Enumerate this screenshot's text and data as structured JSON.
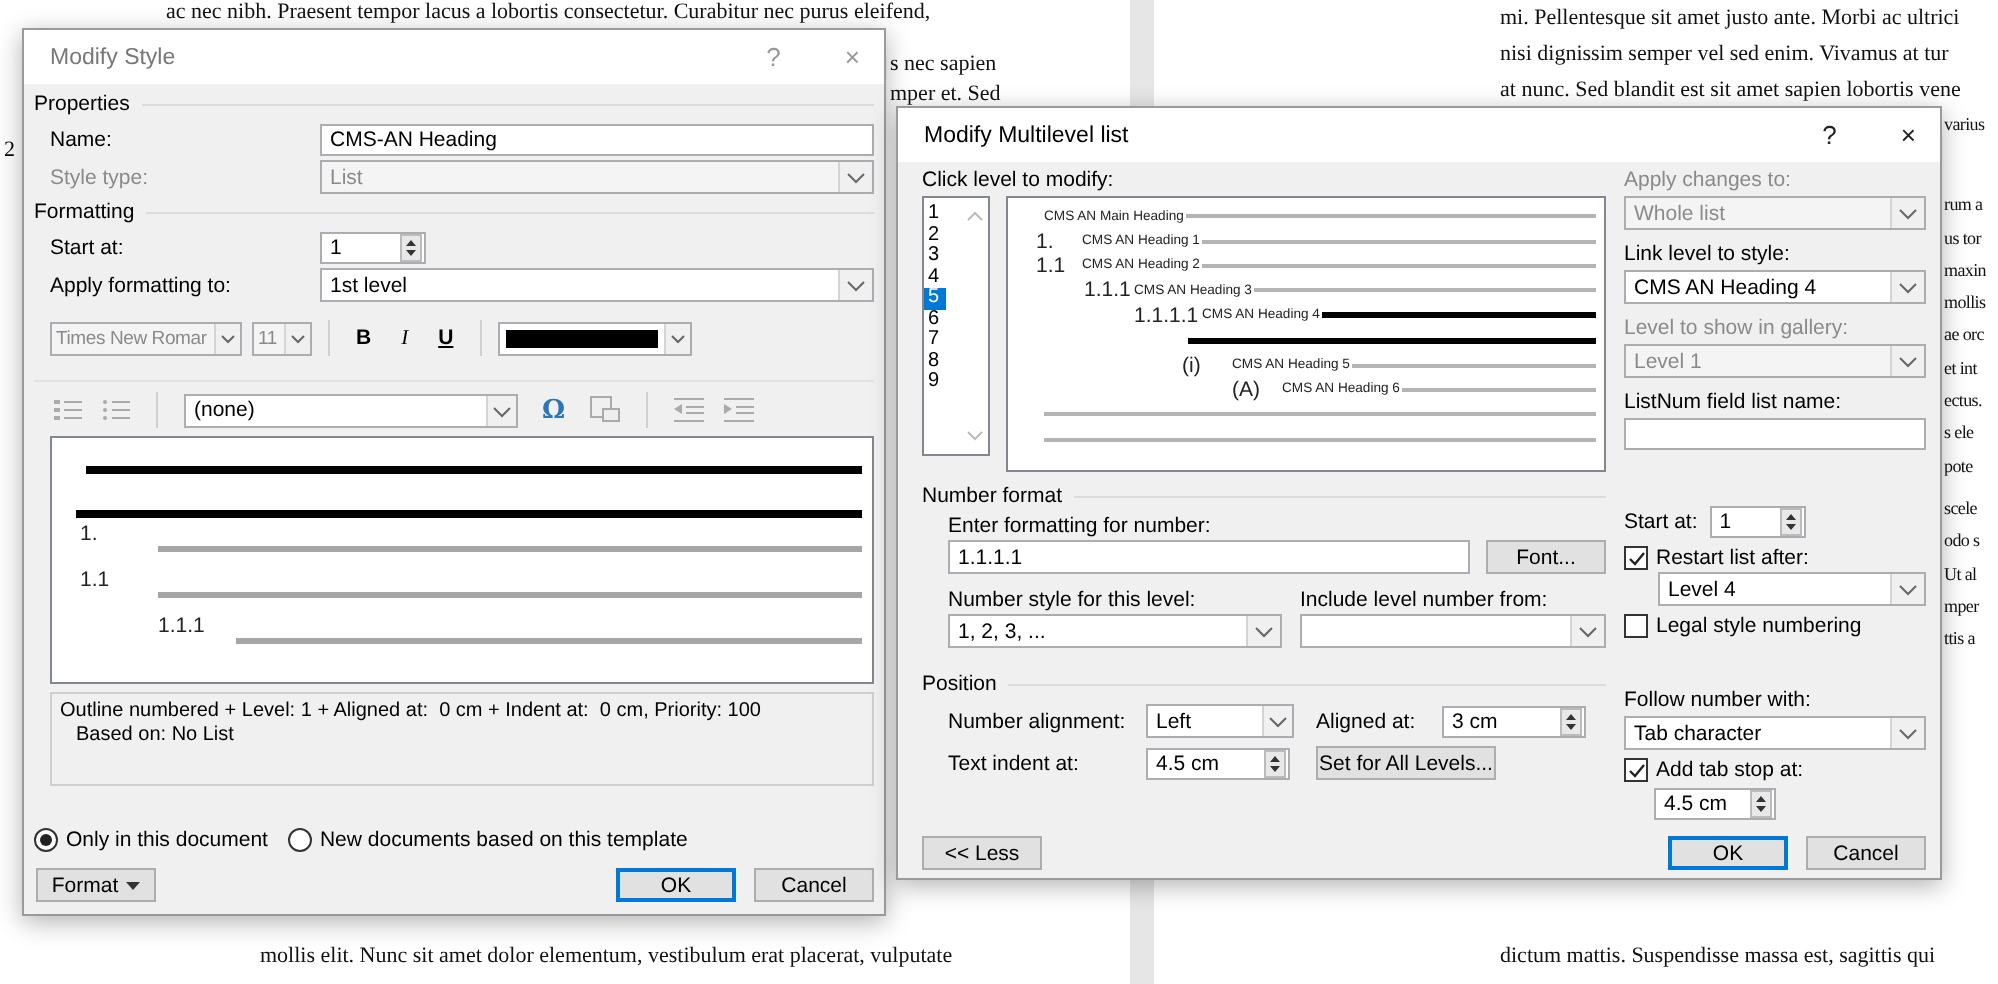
{
  "document": {
    "left_top_line": "ac nec nibh. Praesent tempor lacus a lobortis consectetur. Curabitur nec purus eleifend,",
    "left_fragments": [
      "s nec sapien",
      "mper et. Sed"
    ],
    "left_margin_number": "2",
    "left_bottom_line": "mollis elit. Nunc sit amet dolor elementum, vestibulum erat placerat, vulputate",
    "right_top_lines": [
      "mi. Pellentesque sit amet justo ante. Morbi ac ultrici",
      "nisi dignissim semper vel sed enim. Vivamus at tur",
      "at nunc. Sed blandit est sit amet sapien lobortis vene"
    ],
    "right_fragment_paragraphs": [
      [
        "varius"
      ],
      [
        "rum a",
        "us tor",
        "maxin",
        "mollis",
        "ae orc",
        "et int",
        "ectus.",
        "s ele",
        "pote"
      ],
      [
        "scele",
        "odo s",
        "Ut al",
        "mper",
        "ttis a"
      ]
    ],
    "right_bottom_line": "dictum mattis. Suspendisse massa est, sagittis qui"
  },
  "modify_style": {
    "title": "Modify Style",
    "help": "?",
    "close": "×",
    "properties_heading": "Properties",
    "name": {
      "label": "Name:",
      "value": "CMS-AN Heading"
    },
    "style_type": {
      "label": "Style type:",
      "value": "List",
      "disabled": true
    },
    "formatting_heading": "Formatting",
    "start_at": {
      "label": "Start at:",
      "value": "1"
    },
    "apply_to": {
      "label": "Apply formatting to:",
      "value": "1st level"
    },
    "font": "Times New Romar",
    "font_size": "11",
    "bold": "B",
    "italic": "I",
    "underline": "U",
    "list_style": "(none)",
    "symbol": "Ω",
    "preview_numbers": [
      "1.",
      "1.1",
      "1.1.1"
    ],
    "description": [
      "Outline numbered + Level: 1 + Aligned at:  0 cm + Indent at:  0 cm, Priority: 100",
      "Based on: No List"
    ],
    "scope_options": [
      {
        "label": "Only in this document",
        "selected": true
      },
      {
        "label": "New documents based on this template",
        "selected": false
      }
    ],
    "format_button": "Format",
    "ok": "OK",
    "cancel": "Cancel"
  },
  "multilevel": {
    "title": "Modify Multilevel list",
    "help": "?",
    "close": "×",
    "level_label": "Click level to modify:",
    "levels": [
      {
        "label": "1",
        "selected": false
      },
      {
        "label": "2",
        "selected": false
      },
      {
        "label": "3",
        "selected": false
      },
      {
        "label": "4",
        "selected": false
      },
      {
        "label": "5",
        "selected": true
      },
      {
        "label": "6",
        "selected": false
      },
      {
        "label": "7",
        "selected": false
      },
      {
        "label": "8",
        "selected": false
      },
      {
        "label": "9",
        "selected": false
      }
    ],
    "preview": [
      {
        "text": "CMS AN Main Heading",
        "selected": false
      },
      {
        "number": "1.",
        "text": "CMS AN Heading 1",
        "selected": false
      },
      {
        "number": "1.1",
        "text": "CMS AN Heading 2",
        "selected": false
      },
      {
        "number": "1.1.1",
        "text": "CMS AN Heading 3",
        "selected": false
      },
      {
        "number": "1.1.1.1",
        "text": "CMS AN Heading 4",
        "selected": true
      },
      {
        "number": "(i)",
        "text": "CMS AN Heading 5",
        "selected": false
      },
      {
        "number": "(A)",
        "text": "CMS AN Heading 6",
        "selected": false
      }
    ],
    "apply_changes": {
      "label": "Apply changes to:",
      "value": "Whole list",
      "disabled": true
    },
    "link_level": {
      "label": "Link level to style:",
      "value": "CMS AN Heading 4",
      "disabled": false
    },
    "gallery_level": {
      "label": "Level to show in gallery:",
      "value": "Level 1",
      "disabled": true
    },
    "listnum_label": "ListNum field list name:",
    "number_format_heading": "Number format",
    "format_label": "Enter formatting for number:",
    "format_value": "1.1.1.1",
    "font_button": "Font...",
    "number_style": {
      "label": "Number style for this level:",
      "value": "1, 2, 3, ..."
    },
    "include_label": "Include level number from:",
    "position_heading": "Position",
    "alignment": {
      "label": "Number alignment:",
      "value": "Left"
    },
    "aligned_at": {
      "label": "Aligned at:",
      "value": "3 cm"
    },
    "text_indent": {
      "label": "Text indent at:",
      "value": "4.5 cm"
    },
    "set_all_button": "Set for All Levels...",
    "start_at": {
      "label": "Start at:",
      "value": "1"
    },
    "restart": {
      "label": "Restart list after:",
      "checked": true,
      "value": "Level 4"
    },
    "legal": {
      "label": "Legal style numbering",
      "checked": false
    },
    "follow": {
      "label": "Follow number with:",
      "value": "Tab character"
    },
    "tab_stop": {
      "label": "Add tab stop at:",
      "checked": true,
      "value": "4.5 cm"
    },
    "less_button": "<< Less",
    "ok": "OK",
    "cancel": "Cancel"
  }
}
